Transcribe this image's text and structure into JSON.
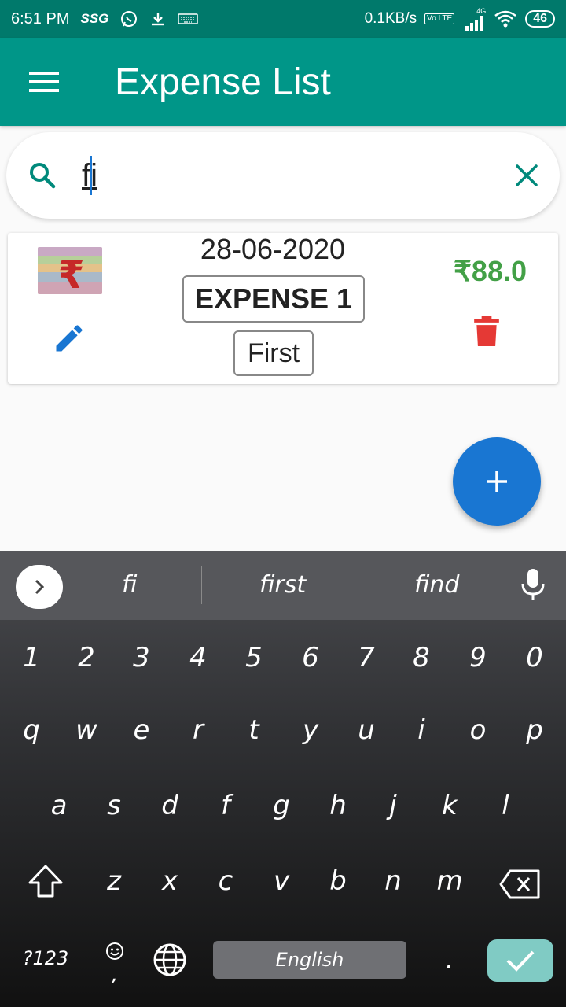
{
  "status_bar": {
    "time": "6:51 PM",
    "carrier_icon_label": "SSG",
    "net_speed": "0.1KB/s",
    "volte_label": "Vo LTE",
    "network_label": "4G",
    "battery": "46"
  },
  "app_bar": {
    "title": "Expense List"
  },
  "search": {
    "value": "fi"
  },
  "expenses": [
    {
      "date": "28-06-2020",
      "name": "EXPENSE 1",
      "category": "First",
      "amount": "₹88.0"
    }
  ],
  "keyboard": {
    "suggestions": [
      "fi",
      "first",
      "find"
    ],
    "number_row": [
      "1",
      "2",
      "3",
      "4",
      "5",
      "6",
      "7",
      "8",
      "9",
      "0"
    ],
    "row1": [
      "q",
      "w",
      "e",
      "r",
      "t",
      "y",
      "u",
      "i",
      "o",
      "p"
    ],
    "row2": [
      "a",
      "s",
      "d",
      "f",
      "g",
      "h",
      "j",
      "k",
      "l"
    ],
    "row3": [
      "z",
      "x",
      "c",
      "v",
      "b",
      "n",
      "m"
    ],
    "symbols_label": "?123",
    "comma_label": ",",
    "space_label": "English",
    "period_label": "."
  },
  "colors": {
    "status_bar": "#00796b",
    "app_bar": "#009688",
    "amount": "#43a047",
    "fab": "#1976d2",
    "delete": "#e53935",
    "enter_key": "#80cbc4"
  },
  "icons": {
    "menu": "menu-icon",
    "search": "search-icon",
    "clear": "close-icon",
    "edit": "pencil-icon",
    "delete": "trash-icon",
    "add": "plus-icon",
    "mic": "mic-icon",
    "shift": "shift-icon",
    "backspace": "backspace-icon",
    "globe": "globe-icon",
    "emoji": "emoji-icon",
    "enter": "check-icon"
  }
}
